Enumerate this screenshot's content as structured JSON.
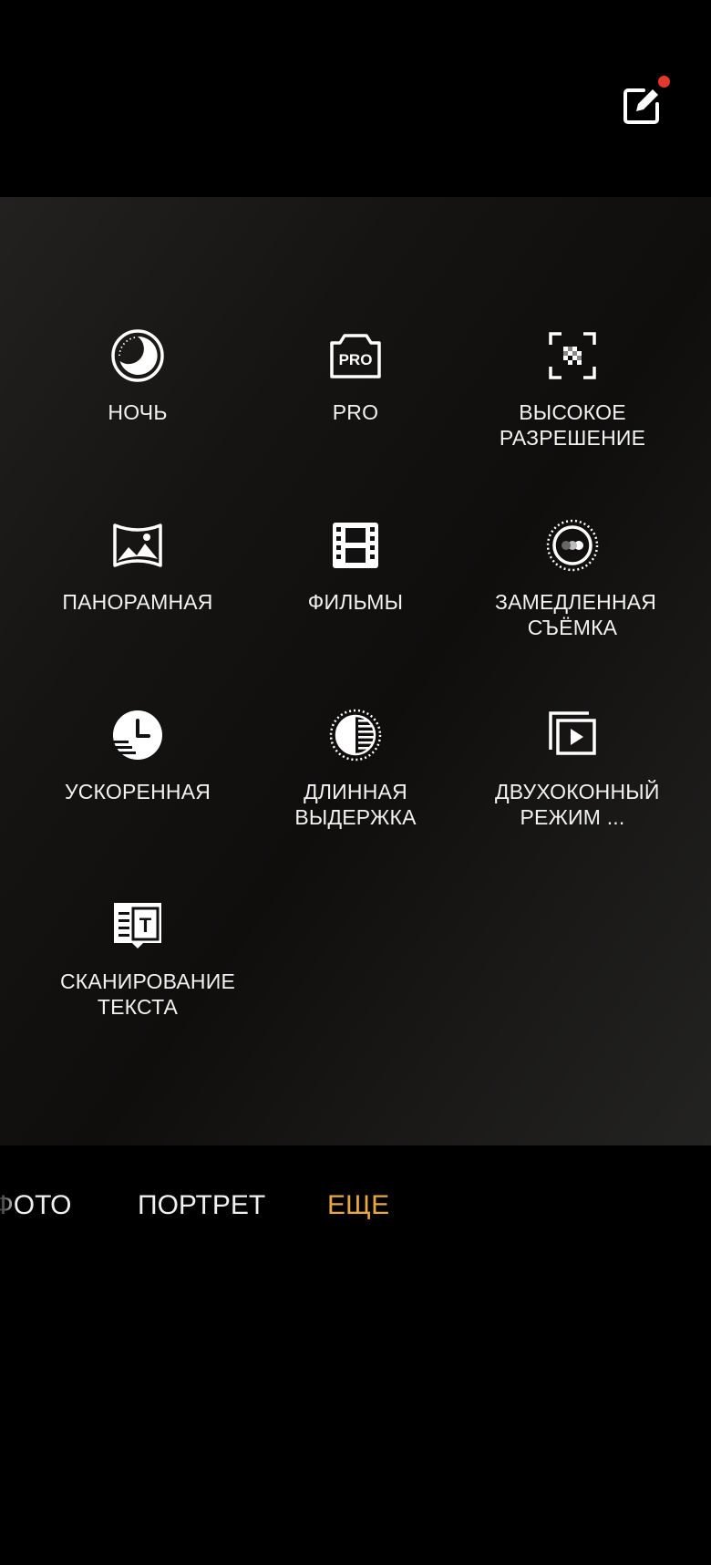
{
  "modes": [
    {
      "id": "night",
      "label": "НОЧЬ",
      "icon": "night-mode-icon"
    },
    {
      "id": "pro",
      "label": "PRO",
      "icon": "pro-camera-icon",
      "icon_text": "PRO"
    },
    {
      "id": "high-res",
      "label": "ВЫСОКОЕ РАЗРЕШЕНИЕ",
      "icon": "high-resolution-icon"
    },
    {
      "id": "panorama",
      "label": "ПАНОРАМНАЯ",
      "icon": "panorama-icon"
    },
    {
      "id": "movies",
      "label": "ФИЛЬМЫ",
      "icon": "film-icon"
    },
    {
      "id": "slow-motion",
      "label": "ЗАМЕДЛЕННАЯ СЪЁМКА",
      "icon": "slow-motion-icon"
    },
    {
      "id": "time-lapse",
      "label": "УСКОРЕННАЯ",
      "icon": "time-lapse-icon"
    },
    {
      "id": "long-exposure",
      "label": "ДЛИННАЯ ВЫДЕРЖКА",
      "icon": "long-exposure-icon"
    },
    {
      "id": "dual-view",
      "label": "ДВУХОКОННЫЙ РЕЖИМ ...",
      "icon": "dual-view-video-icon"
    },
    {
      "id": "text-scan",
      "label": "СКАНИРОВАНИЕ ТЕКСТА",
      "icon": "text-scanner-icon",
      "icon_text": "T"
    }
  ],
  "bottom_tabs": {
    "photo": "ФОТО",
    "portrait": "ПОРТРЕТ",
    "more": "ЕЩЕ"
  },
  "colors": {
    "active_tab": "#e7a83f",
    "notification_dot": "#e2392c",
    "text": "#f2f2f2",
    "background": "#000000"
  },
  "top_bar": {
    "edit_icon": "edit-icon",
    "has_notification": true
  }
}
